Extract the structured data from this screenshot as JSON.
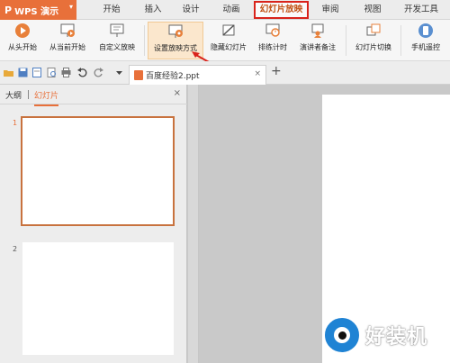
{
  "app": {
    "logo": "P",
    "name": "WPS 演示",
    "caret": "▾"
  },
  "menu": {
    "tabs": [
      "开始",
      "插入",
      "设计",
      "动画",
      "幻灯片放映",
      "审阅",
      "视图",
      "开发工具"
    ],
    "active": "幻灯片放映"
  },
  "ribbon": {
    "buttons": {
      "from_start": "从头开始",
      "from_current": "从当前开始",
      "custom_show": "自定义放映",
      "setup_show": "设置放映方式",
      "hide_slide": "隐藏幻灯片",
      "rehearse": "排练计时",
      "presenter_notes": "演讲者备注",
      "slide_switch": "幻灯片切换",
      "phone_remote": "手机遥控"
    }
  },
  "doc_tab": {
    "filename": "百度经验2.ppt",
    "close": "×",
    "add": "+"
  },
  "left_pane": {
    "tab_outline": "大纲",
    "tab_slides": "幻灯片",
    "close": "×",
    "slides": [
      {
        "number": "1"
      },
      {
        "number": "2"
      }
    ]
  },
  "watermark": {
    "text": "好装机"
  },
  "colors": {
    "accent": "#e8703a",
    "active_tab_border": "#d9231b",
    "highlight": "#fbe7cd",
    "arrow": "#d9231b",
    "watermark_badge": "#1f83d4"
  }
}
